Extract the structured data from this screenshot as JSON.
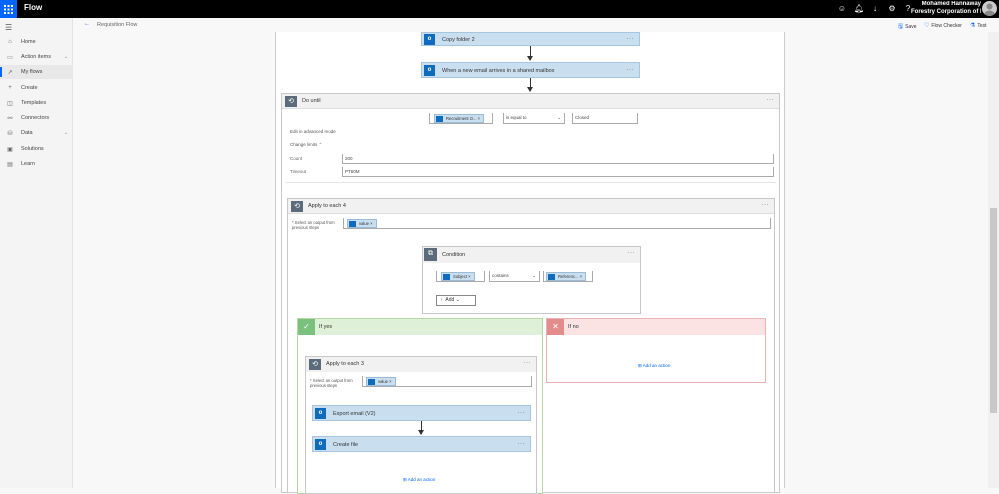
{
  "topbar": {
    "brand": "Flow",
    "user_name": "Mohamed Hannaway",
    "user_org": "Forestry Corporation of N"
  },
  "sidebar": {
    "items": [
      {
        "label": "Home"
      },
      {
        "label": "Action items"
      },
      {
        "label": "My flows"
      },
      {
        "label": "Create"
      },
      {
        "label": "Templates"
      },
      {
        "label": "Connectors"
      },
      {
        "label": "Data"
      },
      {
        "label": "Solutions"
      },
      {
        "label": "Learn"
      }
    ]
  },
  "cmdbar": {
    "breadcrumb": "Requisition Flow",
    "save": "Save",
    "checker": "Flow Checker",
    "test": "Test"
  },
  "flow": {
    "step_copy": "Copy folder 2",
    "step_trigger": "When a new email arrives in a shared mailbox",
    "do_until": {
      "title": "Do until",
      "token": "Recruitment O...",
      "operator": "is equal to",
      "value": "Closed",
      "advanced": "Edit in advanced mode",
      "limits": "Change limits",
      "count_label": "Count",
      "count": "200",
      "timeout_label": "Timeout",
      "timeout": "PT60M"
    },
    "apply4": {
      "title": "Apply to each 4",
      "select_label": "* Select an output from previous steps",
      "token": "value"
    },
    "condition": {
      "title": "Condition",
      "left": "Subject",
      "operator": "contains",
      "right": "Referenc...",
      "add": "Add"
    },
    "if_yes": "If yes",
    "if_no": "If no",
    "apply3": {
      "title": "Apply to each 3",
      "select_label": "* Select an output from previous steps",
      "token": "value"
    },
    "step_export": "Export email (V2)",
    "step_create": "Create file",
    "add_action": "Add an action"
  }
}
